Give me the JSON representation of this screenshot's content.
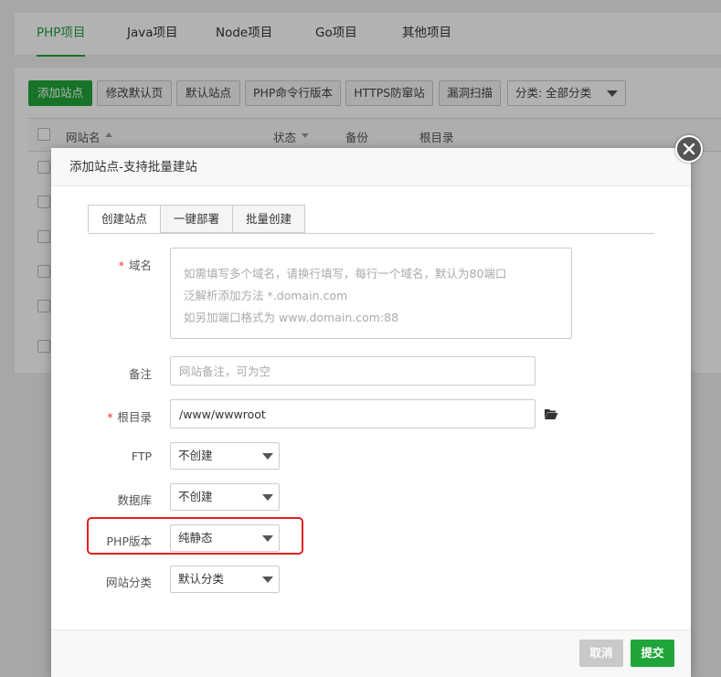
{
  "top_tabs": [
    "PHP项目",
    "Java项目",
    "Node项目",
    "Go项目",
    "其他项目"
  ],
  "toolbar": {
    "add_site": "添加站点",
    "modify_default_page": "修改默认页",
    "default_site": "默认站点",
    "php_cli_version": "PHP命令行版本",
    "https_anti_block": "HTTPS防窜站",
    "vuln_scan": "漏洞扫描",
    "category_select": "分类: 全部分类"
  },
  "table_headers": {
    "site_name": "网站名",
    "status": "状态",
    "backup": "备份",
    "root_dir": "根目录"
  },
  "modal": {
    "title": "添加站点-支持批量建站",
    "tabs": [
      "创建站点",
      "一键部署",
      "批量创建"
    ],
    "domain": {
      "label": "域名",
      "placeholder_lines": [
        "如需填写多个域名，请换行填写，每行一个域名，默认为80端口",
        "泛解析添加方法 *.domain.com",
        "如另加端口格式为 www.domain.com:88"
      ]
    },
    "remark": {
      "label": "备注",
      "placeholder": "网站备注，可为空"
    },
    "root": {
      "label": "根目录",
      "value": "/www/wwwroot"
    },
    "ftp": {
      "label": "FTP",
      "value": "不创建"
    },
    "database": {
      "label": "数据库",
      "value": "不创建"
    },
    "php_version": {
      "label": "PHP版本",
      "value": "纯静态"
    },
    "site_category": {
      "label": "网站分类",
      "value": "默认分类"
    },
    "cancel": "取消",
    "submit": "提交"
  },
  "colors": {
    "brand_green": "#20a53a",
    "highlight_red": "#e02020",
    "cancel_gray": "#c9c9c9"
  }
}
